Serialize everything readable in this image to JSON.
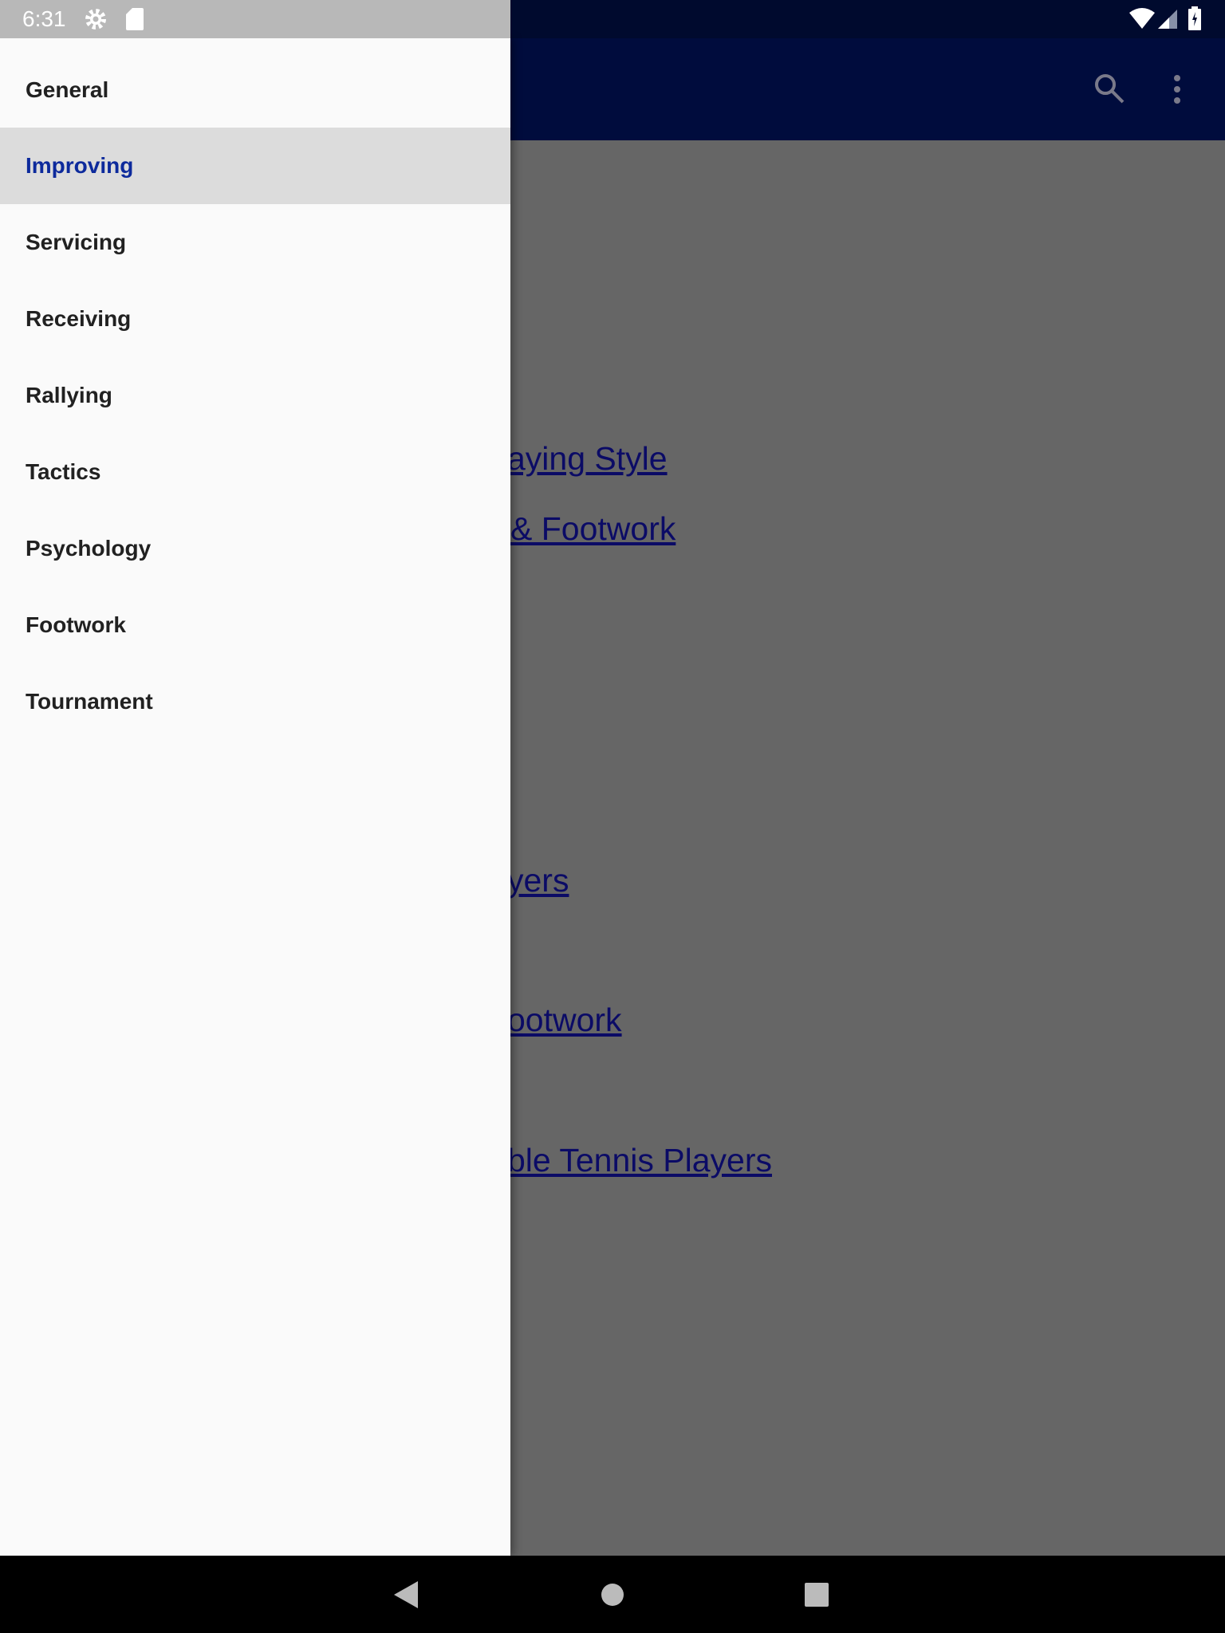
{
  "status_bar": {
    "time": "6:31",
    "icons": [
      "settings-icon",
      "sd-card-icon",
      "wifi-icon",
      "signal-icon",
      "battery-charging-icon"
    ]
  },
  "toolbar": {
    "icons": [
      "search-icon",
      "more-vert-icon"
    ]
  },
  "content": {
    "links": [
      "aying Style",
      " & Footwork",
      "yers",
      "ootwork",
      "ble Tennis Players"
    ]
  },
  "drawer": {
    "items": [
      {
        "label": "General"
      },
      {
        "label": "Improving",
        "selected": true
      },
      {
        "label": "Servicing"
      },
      {
        "label": "Receiving"
      },
      {
        "label": "Rallying"
      },
      {
        "label": "Tactics"
      },
      {
        "label": "Psychology"
      },
      {
        "label": "Footwork"
      },
      {
        "label": "Tournament"
      }
    ]
  },
  "colors": {
    "toolbar": "#000c3d",
    "selected_text": "#0d2a9c",
    "link": "#0b0b66"
  },
  "nav_bar": {
    "icons": [
      "back-icon",
      "home-icon",
      "recents-icon"
    ]
  }
}
